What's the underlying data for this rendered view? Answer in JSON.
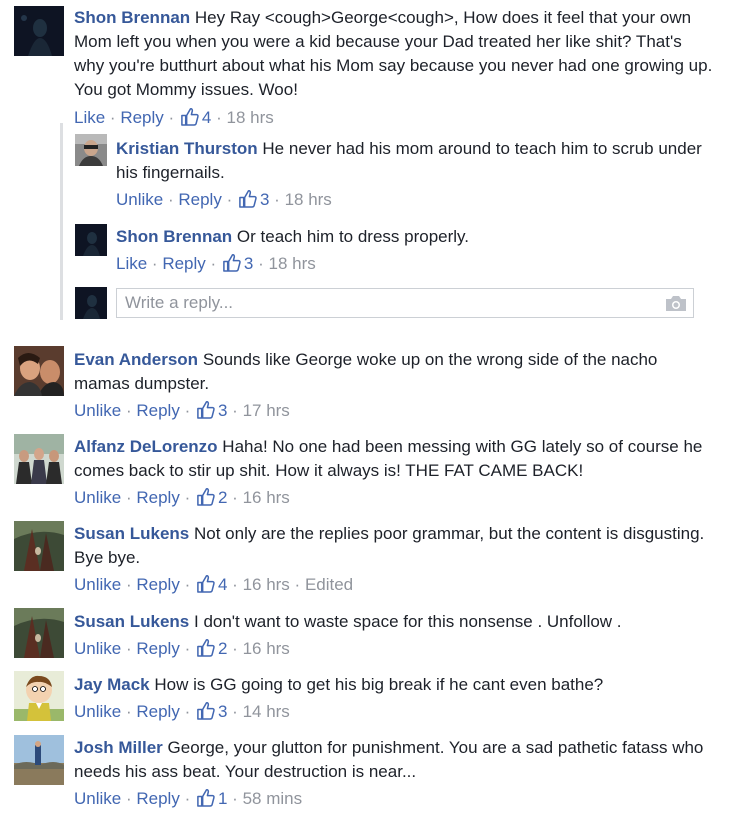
{
  "comments": [
    {
      "author": "Shon Brennan",
      "text": "Hey Ray <cough>George<cough>, How does it feel that your own Mom left you when you were a kid because your Dad treated her like shit? That's why you're butthurt about what his Mom say because you never had one growing up. You got Mommy issues. Woo!",
      "action": "Like",
      "reply": "Reply",
      "likes": "4",
      "time": "18 hrs",
      "replies": [
        {
          "author": "Kristian Thurston",
          "text": "He never had his mom around to teach him to scrub under his fingernails.",
          "action": "Unlike",
          "reply": "Reply",
          "likes": "3",
          "time": "18 hrs"
        },
        {
          "author": "Shon Brennan",
          "text": "Or teach him to dress properly.",
          "action": "Like",
          "reply": "Reply",
          "likes": "3",
          "time": "18 hrs"
        }
      ],
      "reply_placeholder": "Write a reply..."
    },
    {
      "author": "Evan Anderson",
      "text": "Sounds like George woke up on the wrong side of the nacho mamas dumpster.",
      "action": "Unlike",
      "reply": "Reply",
      "likes": "3",
      "time": "17 hrs"
    },
    {
      "author": "Alfanz DeLorenzo",
      "text": "Haha! No one had been messing with GG lately so of course he comes back to stir up shit. How it always is! THE FAT CAME BACK!",
      "action": "Unlike",
      "reply": "Reply",
      "likes": "2",
      "time": "16 hrs"
    },
    {
      "author": "Susan Lukens",
      "text": "Not only are the replies poor grammar, but the content is disgusting. Bye bye.",
      "action": "Unlike",
      "reply": "Reply",
      "likes": "4",
      "time": "16 hrs",
      "edited": "Edited"
    },
    {
      "author": "Susan Lukens",
      "text": "I don't want to waste space for this nonsense . Unfollow .",
      "action": "Unlike",
      "reply": "Reply",
      "likes": "2",
      "time": "16 hrs"
    },
    {
      "author": "Jay Mack",
      "text": "How is GG going to get his big break if he cant even bathe?",
      "action": "Unlike",
      "reply": "Reply",
      "likes": "3",
      "time": "14 hrs"
    },
    {
      "author": "Josh Miller",
      "text": "George, your glutton for punishment. You are a sad pathetic fatass who needs his ass beat. Your destruction is near...",
      "action": "Unlike",
      "reply": "Reply",
      "likes": "1",
      "time": "58 mins"
    }
  ],
  "colors": {
    "name": "#365899",
    "link": "#4267b2",
    "meta": "#90949c",
    "text": "#1d2129"
  },
  "icons": {
    "like": "thumbs-up-icon",
    "camera": "camera-icon"
  }
}
